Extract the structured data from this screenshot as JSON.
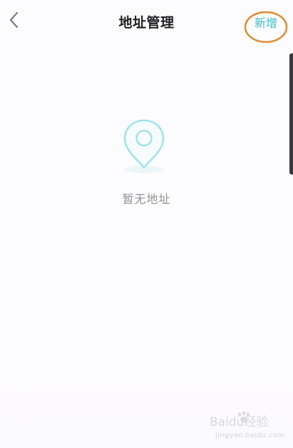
{
  "header": {
    "title": "地址管理",
    "back_icon": "chevron-left-icon",
    "add_label": "新增"
  },
  "empty_state": {
    "icon": "location-pin-icon",
    "message": "暂无地址"
  },
  "watermark": {
    "brand": "Baidu经验",
    "url": "jingyan.baidu.com"
  },
  "colors": {
    "accent": "#38c0cf",
    "title_text": "#1f1f24",
    "muted_text": "#8f8f96",
    "annotation_ring": "#e08a2c",
    "background": "#fdfcfe"
  }
}
